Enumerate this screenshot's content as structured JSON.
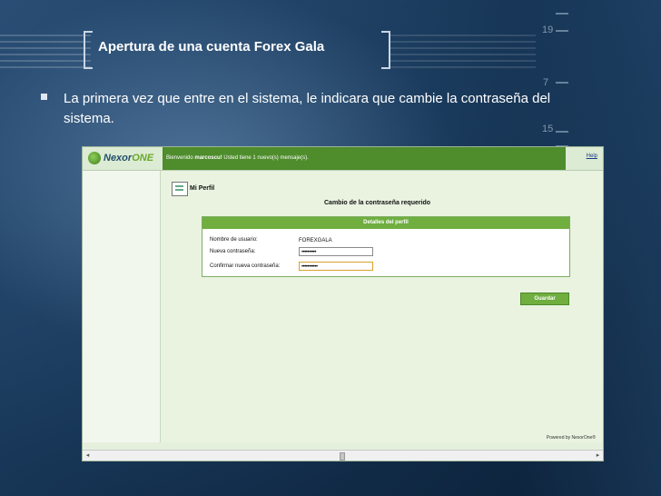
{
  "slide": {
    "title": "Apertura de una cuenta Forex Gala",
    "bullet_text": "La primera vez que entre en el sistema, le indicara que cambie la contraseña del sistema."
  },
  "decor": {
    "numbers": [
      "19",
      "7",
      "15"
    ]
  },
  "app": {
    "logo_prefix": "Nexor",
    "logo_suffix": "ONE",
    "welcome_prefix": "Bienvenido",
    "welcome_user": "marcoscu!",
    "welcome_suffix": "Usted tiene 1 nuevo(s) mensaje(s).",
    "help_link": "Help",
    "profile_title": "Mi Perfil",
    "required_title": "Cambio de la contraseña requerido",
    "panel_header": "Detalles del perfil",
    "fields": {
      "username_label": "Nombre de usuario:",
      "username_value": "FOREXGALA",
      "new_password_label": "Nueva contraseña:",
      "new_password_value": "••••••••••",
      "confirm_password_label": "Confirmar nueva contraseña:",
      "confirm_password_value": "•••••••••••"
    },
    "save_button": "Guardar",
    "powered_by": "Powered by NexorOne®"
  },
  "colors": {
    "accent": "#6fae3f",
    "header_green": "#4e8c2c",
    "background": "#163454"
  }
}
